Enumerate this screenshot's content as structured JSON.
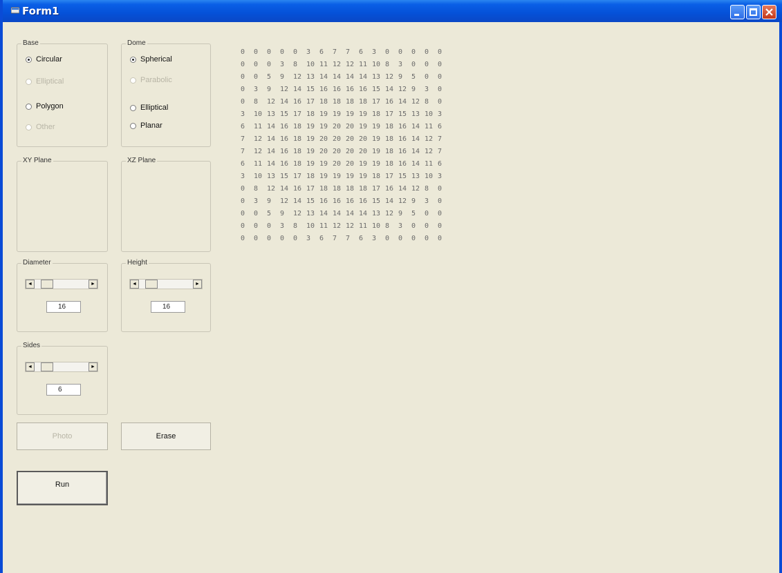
{
  "window": {
    "title": "Form1"
  },
  "base": {
    "legend": "Base",
    "options": [
      {
        "label": "Circular",
        "checked": true,
        "enabled": true
      },
      {
        "label": "Elliptical",
        "checked": false,
        "enabled": false
      },
      {
        "label": "Polygon",
        "checked": false,
        "enabled": true
      },
      {
        "label": "Other",
        "checked": false,
        "enabled": false
      }
    ]
  },
  "dome": {
    "legend": "Dome",
    "options": [
      {
        "label": "Spherical",
        "checked": true,
        "enabled": true
      },
      {
        "label": "Parabolic",
        "checked": false,
        "enabled": false
      },
      {
        "label": "Elliptical",
        "checked": false,
        "enabled": true
      },
      {
        "label": "Planar",
        "checked": false,
        "enabled": true
      }
    ]
  },
  "xy_plane": {
    "legend": "XY Plane"
  },
  "xz_plane": {
    "legend": "XZ Plane"
  },
  "diameter": {
    "legend": "Diameter",
    "value": "16"
  },
  "height": {
    "legend": "Height",
    "value": "16"
  },
  "sides": {
    "legend": "Sides",
    "value": "6"
  },
  "buttons": {
    "photo": "Photo",
    "erase": "Erase",
    "run": "Run"
  },
  "grid": [
    [
      "0",
      "0",
      "0",
      "0",
      "0",
      "3",
      "6",
      "7",
      "7",
      "6",
      "3",
      "0",
      "0",
      "0",
      "0",
      "0"
    ],
    [
      "0",
      "0",
      "0",
      "3",
      "8",
      "10",
      "11",
      "12",
      "12",
      "11",
      "10",
      "8",
      "3",
      "0",
      "0",
      "0"
    ],
    [
      "0",
      "0",
      "5",
      "9",
      "12",
      "13",
      "14",
      "14",
      "14",
      "14",
      "13",
      "12",
      "9",
      "5",
      "0",
      "0"
    ],
    [
      "0",
      "3",
      "9",
      "12",
      "14",
      "15",
      "16",
      "16",
      "16",
      "16",
      "15",
      "14",
      "12",
      "9",
      "3",
      "0"
    ],
    [
      "0",
      "8",
      "12",
      "14",
      "16",
      "17",
      "18",
      "18",
      "18",
      "18",
      "17",
      "16",
      "14",
      "12",
      "8",
      "0"
    ],
    [
      "3",
      "10",
      "13",
      "15",
      "17",
      "18",
      "19",
      "19",
      "19",
      "19",
      "18",
      "17",
      "15",
      "13",
      "10",
      "3"
    ],
    [
      "6",
      "11",
      "14",
      "16",
      "18",
      "19",
      "19",
      "20",
      "20",
      "19",
      "19",
      "18",
      "16",
      "14",
      "11",
      "6"
    ],
    [
      "7",
      "12",
      "14",
      "16",
      "18",
      "19",
      "20",
      "20",
      "20",
      "20",
      "19",
      "18",
      "16",
      "14",
      "12",
      "7"
    ],
    [
      "7",
      "12",
      "14",
      "16",
      "18",
      "19",
      "20",
      "20",
      "20",
      "20",
      "19",
      "18",
      "16",
      "14",
      "12",
      "7"
    ],
    [
      "6",
      "11",
      "14",
      "16",
      "18",
      "19",
      "19",
      "20",
      "20",
      "19",
      "19",
      "18",
      "16",
      "14",
      "11",
      "6"
    ],
    [
      "3",
      "10",
      "13",
      "15",
      "17",
      "18",
      "19",
      "19",
      "19",
      "19",
      "18",
      "17",
      "15",
      "13",
      "10",
      "3"
    ],
    [
      "0",
      "8",
      "12",
      "14",
      "16",
      "17",
      "18",
      "18",
      "18",
      "18",
      "17",
      "16",
      "14",
      "12",
      "8",
      "0"
    ],
    [
      "0",
      "3",
      "9",
      "12",
      "14",
      "15",
      "16",
      "16",
      "16",
      "16",
      "15",
      "14",
      "12",
      "9",
      "3",
      "0"
    ],
    [
      "0",
      "0",
      "5",
      "9",
      "12",
      "13",
      "14",
      "14",
      "14",
      "14",
      "13",
      "12",
      "9",
      "5",
      "0",
      "0"
    ],
    [
      "0",
      "0",
      "0",
      "3",
      "8",
      "10",
      "11",
      "12",
      "12",
      "11",
      "10",
      "8",
      "3",
      "0",
      "0",
      "0"
    ],
    [
      "0",
      "0",
      "0",
      "0",
      "0",
      "3",
      "6",
      "7",
      "7",
      "6",
      "3",
      "0",
      "0",
      "0",
      "0",
      "0"
    ]
  ]
}
